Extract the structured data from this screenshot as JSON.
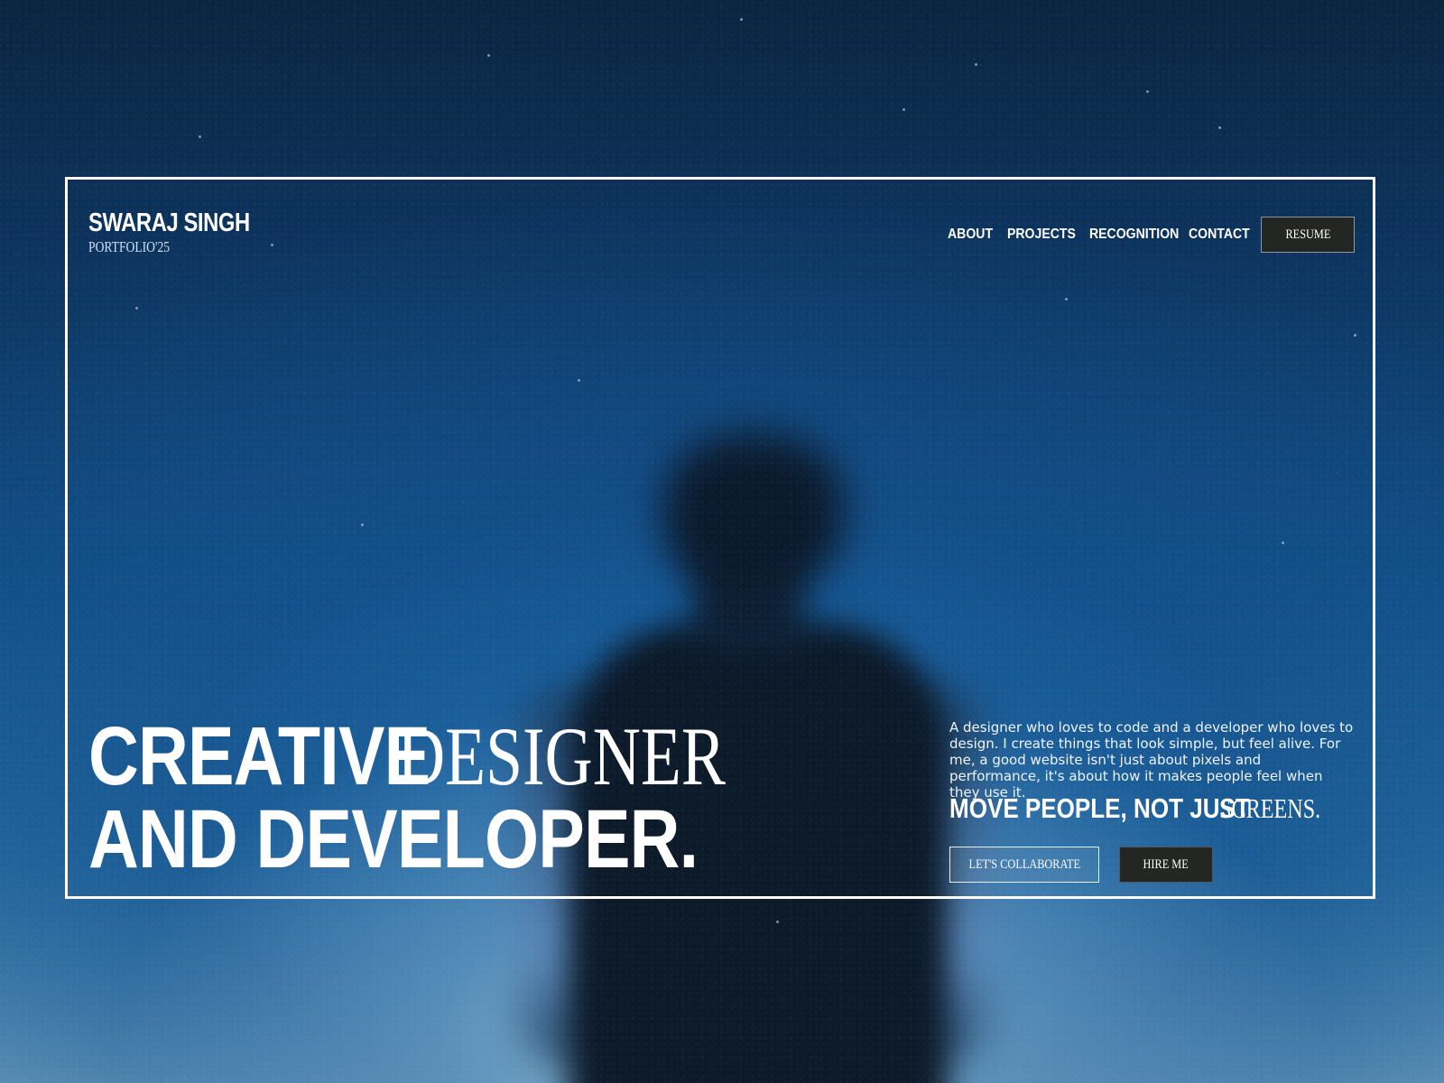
{
  "brand": {
    "name": "SWARAJ SINGH",
    "subtitle": "PORTFOLIO'25"
  },
  "nav": {
    "items": [
      {
        "label": "ABOUT"
      },
      {
        "label": "PROJECTS"
      },
      {
        "label": "RECOGNITION"
      },
      {
        "label": "CONTACT"
      }
    ],
    "resume_label": "RESUME"
  },
  "hero": {
    "line1_strong": "CREATIVE",
    "line1_serif": "DESIGNER",
    "line2_strong": "AND DEVELOPER."
  },
  "intro": {
    "description": "A designer who loves to code and a developer who loves to design. I create things that look simple, but feel alive. For me, a good website isn't just about pixels and performance, it's about how it makes people feel when they use it.",
    "tagline_strong": "MOVE PEOPLE, NOT JUST",
    "tagline_serif": "SCREENS."
  },
  "actions": {
    "collaborate_label": "LET'S COLLABORATE",
    "hire_label": "HIRE ME"
  },
  "colors": {
    "frame_border": "#ffffff",
    "dark_button": "#232623",
    "background_top": "#0a2540",
    "background_bottom": "#6da0c0"
  }
}
